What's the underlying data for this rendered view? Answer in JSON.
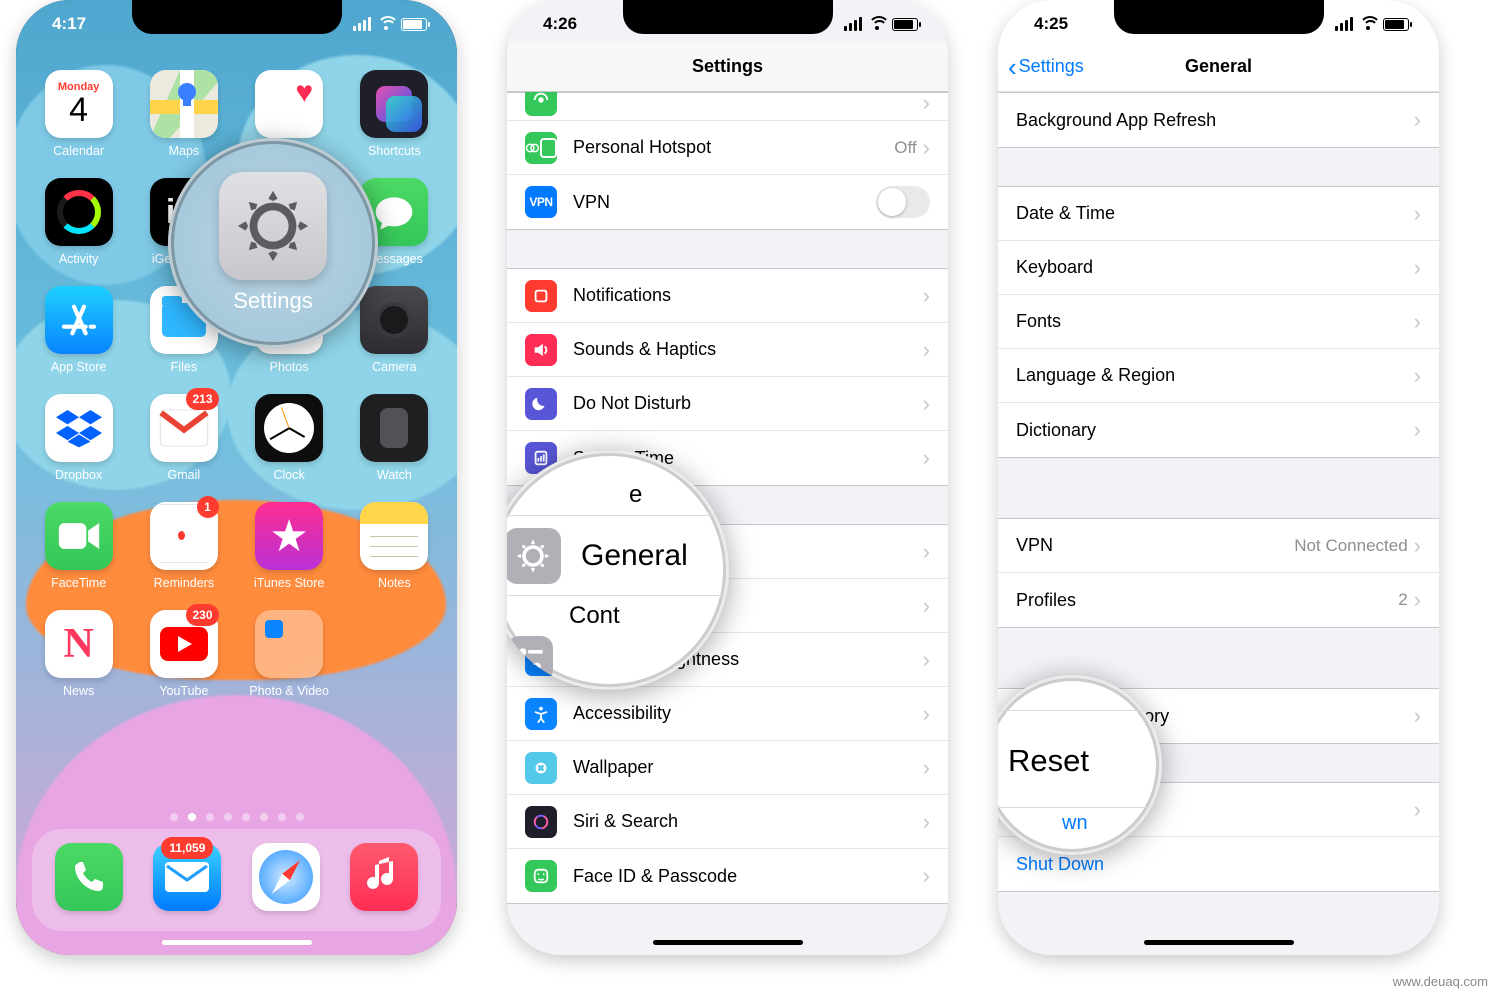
{
  "watermark": "www.deuaq.com",
  "phone1": {
    "status": {
      "time": "4:17"
    },
    "calendar": {
      "weekday": "Monday",
      "day": "4"
    },
    "apps": {
      "calendar": "Calendar",
      "maps": "Maps",
      "health": "Health",
      "shortcuts": "Shortcuts",
      "activity": "Activity",
      "igeeks": "iGeeksBlog",
      "settings": "Settings",
      "messages": "Messages",
      "appstore": "App Store",
      "files": "Files",
      "photos": "Photos",
      "camera": "Camera",
      "dropbox": "Dropbox",
      "gmail": "Gmail",
      "clock": "Clock",
      "watch": "Watch",
      "facetime": "FaceTime",
      "reminders": "Reminders",
      "itunes": "iTunes Store",
      "notes": "Notes",
      "news": "News",
      "youtube": "YouTube",
      "folder": "Photo & Video"
    },
    "badges": {
      "gmail": "213",
      "reminders": "1",
      "youtube": "230",
      "mail": "11,059"
    },
    "magnified": {
      "label": "Settings"
    },
    "igeeks_glyph": "iG"
  },
  "phone2": {
    "status": {
      "time": "4:26"
    },
    "title": "Settings",
    "rows": {
      "cellular": "Cellular",
      "hotspot": "Personal Hotspot",
      "hotspot_detail": "Off",
      "vpn": "VPN",
      "vpn_icon_text": "VPN",
      "notifications": "Notifications",
      "sounds": "Sounds & Haptics",
      "dnd": "Do Not Disturb",
      "screentime": "Screen Time",
      "general": "General",
      "control": "Control Center",
      "display": "Display & Brightness",
      "accessibility": "Accessibility",
      "wallpaper": "Wallpaper",
      "siri": "Siri & Search",
      "faceid": "Face ID & Passcode"
    },
    "magnified": {
      "top_fragment": "e",
      "main": "General",
      "bottom_fragment": "Cont"
    }
  },
  "phone3": {
    "status": {
      "time": "4:25"
    },
    "back": "Settings",
    "title": "General",
    "rows": {
      "background_refresh": "Background App Refresh",
      "date_time": "Date & Time",
      "keyboard": "Keyboard",
      "fonts": "Fonts",
      "language": "Language & Region",
      "dictionary": "Dictionary",
      "vpn": "VPN",
      "vpn_detail": "Not Connected",
      "profiles": "Profiles",
      "profiles_detail": "2",
      "legal": "Legal & Regulatory",
      "reset": "Reset",
      "shutdown": "Shut Down"
    },
    "magnified": {
      "label": "Reset",
      "bottom_fragment": "wn"
    }
  }
}
